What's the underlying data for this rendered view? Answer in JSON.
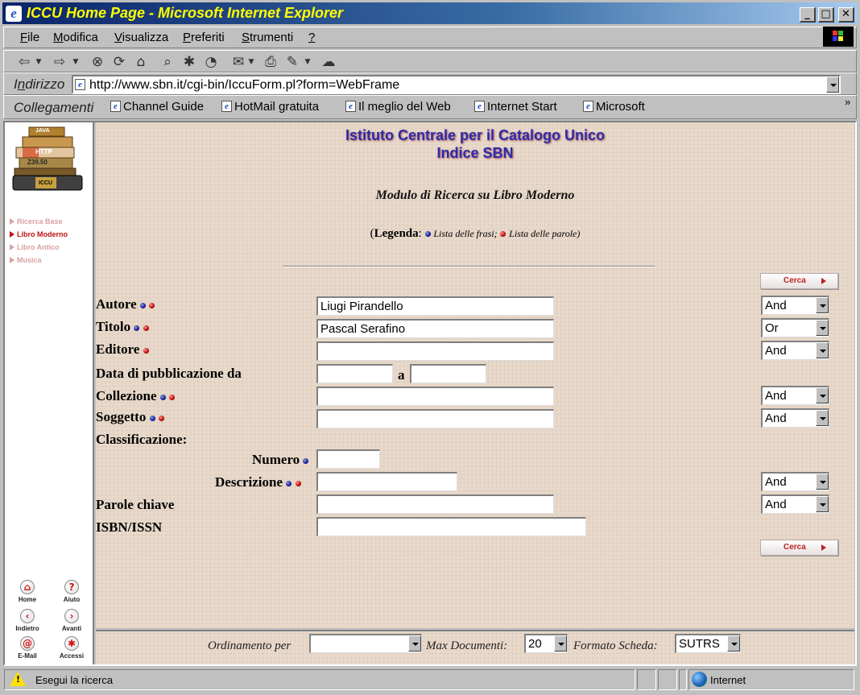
{
  "window": {
    "title": "ICCU Home Page - Microsoft Internet Explorer",
    "controls": {
      "minimize": "_",
      "maximize": "□",
      "close": "✕"
    }
  },
  "menu": [
    {
      "label": "File",
      "u": "F",
      "rest": "ile"
    },
    {
      "label": "Modifica",
      "u": "M",
      "rest": "odifica"
    },
    {
      "label": "Visualizza",
      "u": "V",
      "rest": "isualizza"
    },
    {
      "label": "Preferiti",
      "u": "P",
      "rest": "referiti"
    },
    {
      "label": "Strumenti",
      "u": "S",
      "rest": "trumenti"
    },
    {
      "label": "?",
      "u": "?",
      "rest": ""
    }
  ],
  "toolbar_icons": [
    "back-icon",
    "forward-icon",
    "stop-icon",
    "refresh-icon",
    "home-icon",
    "search-icon",
    "favorites-icon",
    "history-icon",
    "mail-icon",
    "print-icon",
    "edit-icon",
    "discuss-icon"
  ],
  "address": {
    "label": "Indirizzo",
    "label_u": "n",
    "url": "http://www.sbn.it/cgi-bin/IccuForm.pl?form=WebFrame"
  },
  "links": {
    "label": "Collegamenti",
    "items": [
      "Channel Guide",
      "HotMail gratuita",
      "Il meglio del Web",
      "Internet Start",
      "Microsoft"
    ],
    "chevron": "»"
  },
  "logo": {
    "labels": [
      "JAVA",
      "HTTP",
      "Z39.50",
      "ICCU"
    ]
  },
  "left_nav": [
    {
      "label": "Ricerca Base",
      "active": false
    },
    {
      "label": "Libro Moderno",
      "active": true
    },
    {
      "label": "Libro Antico",
      "active": false
    },
    {
      "label": "Musica",
      "active": false
    }
  ],
  "nav_buttons": [
    {
      "label": "Home",
      "glyph": "⌂"
    },
    {
      "label": "Aiuto",
      "glyph": "?"
    },
    {
      "label": "Indietro",
      "glyph": "‹"
    },
    {
      "label": "Avanti",
      "glyph": "›"
    },
    {
      "label": "E-Mail",
      "glyph": "@"
    },
    {
      "label": "Accessi",
      "glyph": "✱"
    }
  ],
  "header": {
    "line1": "Istituto Centrale per il Catalogo Unico",
    "line2": "Indice SBN",
    "form_title": "Modulo di Ricerca su Libro Moderno"
  },
  "legend": {
    "open": "(",
    "title": "Legenda",
    "colon": ":",
    "phrases": "Lista delle frasi;",
    "words": "Lista delle parole)"
  },
  "cerca_label": "Cerca",
  "fields": {
    "autore": {
      "label": "Autore",
      "value": "Liugi Pirandello",
      "op": "And"
    },
    "titolo": {
      "label": "Titolo",
      "value": "Pascal Serafino",
      "op": "Or"
    },
    "editore": {
      "label": "Editore",
      "value": "",
      "op": "And"
    },
    "data": {
      "label": "Data di pubblicazione da",
      "sep": "a",
      "from": "",
      "to": ""
    },
    "collezione": {
      "label": "Collezione",
      "value": "",
      "op": "And"
    },
    "soggetto": {
      "label": "Soggetto",
      "value": "",
      "op": "And"
    },
    "classificazione": {
      "label": "Classificazione:"
    },
    "numero": {
      "label": "Numero",
      "value": ""
    },
    "descrizione": {
      "label": "Descrizione",
      "value": "",
      "op": "And"
    },
    "parole": {
      "label": "Parole chiave",
      "value": "",
      "op": "And"
    },
    "isbn": {
      "label": "ISBN/ISSN",
      "value": ""
    }
  },
  "bottom": {
    "ordinamento_label": "Ordinamento per",
    "ordinamento_value": "",
    "max_label": "Max Documenti:",
    "max_value": "20",
    "formato_label": "Formato Scheda:",
    "formato_value": "SUTRS"
  },
  "status": {
    "text": "Esegui la ricerca",
    "zone": "Internet"
  }
}
